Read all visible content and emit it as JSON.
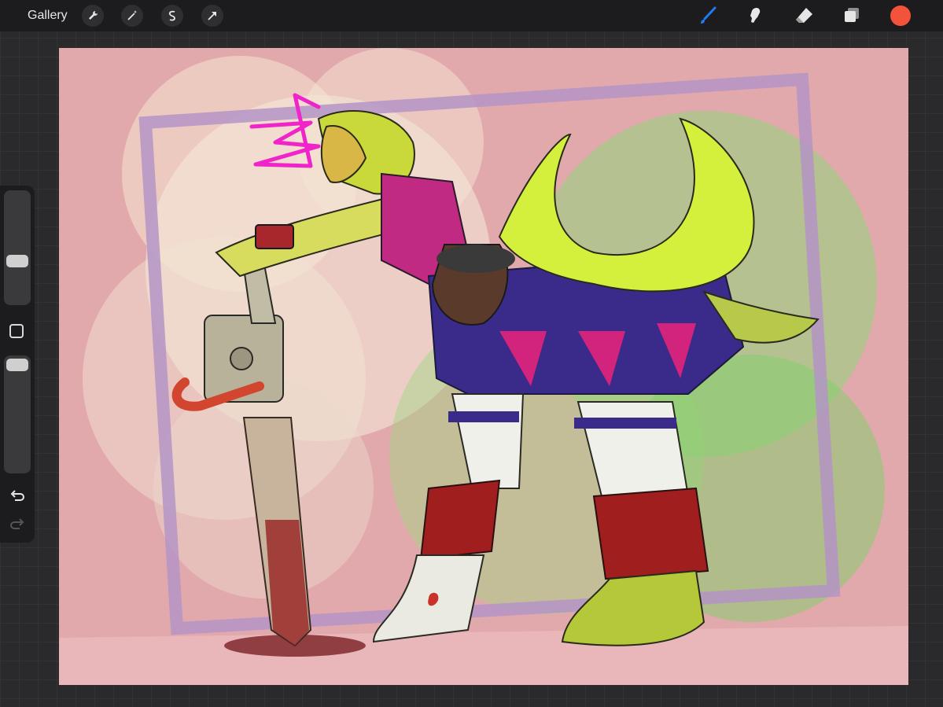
{
  "toolbar": {
    "gallery_label": "Gallery",
    "left_tools": [
      "wrench-icon",
      "magic-wand-icon",
      "selection-icon",
      "transform-arrow-icon"
    ],
    "right_tools": [
      "brush-icon",
      "smudge-icon",
      "eraser-icon",
      "layers-icon"
    ],
    "current_color": "#f2533a",
    "active_tool_color": "#1e7bf0"
  },
  "sidebar": {
    "brush_size_level": 0.25,
    "opacity_level": 0.05,
    "buttons": [
      "modify-square",
      "undo-icon",
      "redo-icon"
    ]
  },
  "canvas": {
    "background_color": "#e2a9ad",
    "frame_color": "#b494c6"
  }
}
